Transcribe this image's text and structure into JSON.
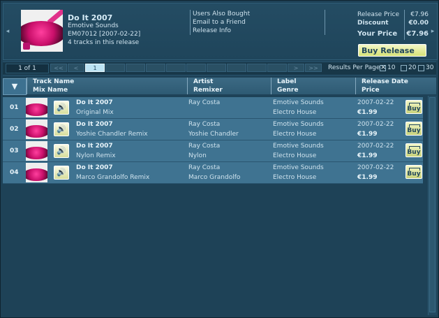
{
  "release": {
    "title": "Do It 2007",
    "label": "Emotive Sounds",
    "catalog_date": "EM07012 [2007-02-22]",
    "tracks_info": "4 tracks in this release"
  },
  "links": [
    "Users Also Bought",
    "Email to a Friend",
    "Release Info"
  ],
  "pricing": {
    "release_price_label": "Release Price",
    "release_price": "€7.96",
    "discount_label": "Discount",
    "discount": "€0.00",
    "your_price_label": "Your Price",
    "your_price": "€7.96",
    "buy_release_label": "Buy Release"
  },
  "pager": {
    "page_indicator": "1 of 1",
    "first": "<<",
    "prev": "<",
    "current_page": "1",
    "next": ">",
    "last": ">>",
    "results_label": "Results Per Page",
    "options": [
      "10",
      "20",
      "30"
    ],
    "selected": "10"
  },
  "columns": {
    "track": "Track Name",
    "mix": "Mix Name",
    "artist": "Artist",
    "remixer": "Remixer",
    "label": "Label",
    "genre": "Genre",
    "date": "Release Date",
    "price": "Price"
  },
  "tracks": [
    {
      "num": "01",
      "name": "Do It 2007",
      "mix": "Original Mix",
      "artist": "Ray Costa",
      "remixer": "",
      "label": "Emotive Sounds",
      "genre": "Electro House",
      "date": "2007-02-22",
      "price": "€1.99"
    },
    {
      "num": "02",
      "name": "Do It 2007",
      "mix": "Yoshie Chandler Remix",
      "artist": "Ray Costa",
      "remixer": "Yoshie Chandler",
      "label": "Emotive Sounds",
      "genre": "Electro House",
      "date": "2007-02-22",
      "price": "€1.99"
    },
    {
      "num": "03",
      "name": "Do It 2007",
      "mix": "Nylon Remix",
      "artist": "Ray Costa",
      "remixer": "Nylon",
      "label": "Emotive Sounds",
      "genre": "Electro House",
      "date": "2007-02-22",
      "price": "€1.99"
    },
    {
      "num": "04",
      "name": "Do It 2007",
      "mix": "Marco Grandolfo Remix",
      "artist": "Ray Costa",
      "remixer": "Marco Grandolfo",
      "label": "Emotive Sounds",
      "genre": "Electro House",
      "date": "2007-02-22",
      "price": "€1.99"
    }
  ],
  "buttons": {
    "buy": "Buy",
    "sort_icon": "▼",
    "play_icon": "🔊",
    "left_arrow": "◂",
    "right_arrow": "▸"
  },
  "colors": {
    "background": "#1e4257",
    "row": "#3f7391",
    "accent": "#d6e178"
  }
}
